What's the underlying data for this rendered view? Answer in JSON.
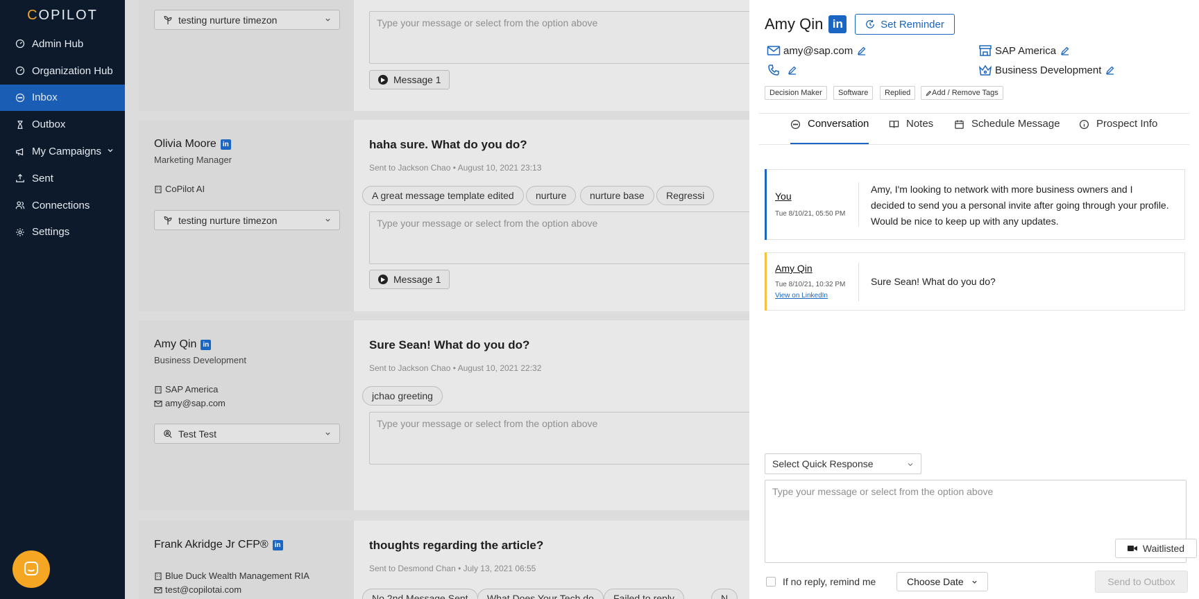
{
  "sidebar": {
    "logo": {
      "first": "C",
      "rest": "OPILOT"
    },
    "items": [
      {
        "label": "Admin Hub",
        "icon": "gauge-icon"
      },
      {
        "label": "Organization Hub",
        "icon": "gauge-icon"
      },
      {
        "label": "Inbox",
        "icon": "chat-icon",
        "active": true
      },
      {
        "label": "Outbox",
        "icon": "hourglass-icon"
      },
      {
        "label": "My Campaigns",
        "icon": "megaphone-icon",
        "has_caret": true
      },
      {
        "label": "Sent",
        "icon": "upload-icon"
      },
      {
        "label": "Connections",
        "icon": "users-icon"
      },
      {
        "label": "Settings",
        "icon": "gear-icon"
      }
    ]
  },
  "cards": [
    {
      "dropdown": "testing nurture timezon",
      "reply_placeholder": "Type your message or select from the option above",
      "message_button": "Message 1"
    },
    {
      "name": "Olivia Moore",
      "role": "Marketing Manager",
      "company": "CoPilot AI",
      "dropdown": "testing nurture timezon",
      "title": "haha sure. What do you do?",
      "sub": "Sent to Jackson Chao • August 10, 2021 23:13",
      "chips": [
        "A great message template edited",
        "nurture",
        "nurture base",
        "Regressi"
      ],
      "reply_placeholder": "Type your message or select from the option above",
      "message_button": "Message 1"
    },
    {
      "name": "Amy Qin",
      "role": "Business Development",
      "company": "SAP America",
      "email": "amy@sap.com",
      "dropdown": "Test Test",
      "title": "Sure Sean! What do you do?",
      "sub": "Sent to Jackson Chao • August 10, 2021 22:32",
      "chips": [
        "jchao greeting"
      ],
      "reply_placeholder": "Type your message or select from the option above"
    },
    {
      "name": "Frank Akridge Jr CFP®",
      "company": "Blue Duck Wealth Management RIA",
      "email": "test@copilotai.com",
      "title": "thoughts regarding the article?",
      "sub": "Sent to Desmond Chan • July 13, 2021 06:55",
      "chips": [
        "No 2nd Message Sent",
        "What Does Your Tech do",
        "Failed to reply",
        "N"
      ]
    }
  ],
  "panel": {
    "name": "Amy Qin",
    "linkedin_badge": "in",
    "reminder_label": "Set Reminder",
    "email": "amy@sap.com",
    "company": "SAP America",
    "department": "Business Development",
    "tags": [
      "Decision Maker",
      "Software",
      "Replied"
    ],
    "add_tags_label": "Add / Remove Tags",
    "tabs": [
      "Conversation",
      "Notes",
      "Schedule Message",
      "Prospect Info"
    ],
    "messages": [
      {
        "sender": "You",
        "time": "Tue 8/10/21, 05:50 PM",
        "text": "Amy, I'm looking to network with more business owners and I decided to send you a personal invite after going through your profile. Would be nice to keep up with any updates.",
        "bar_color": "#1a66c2"
      },
      {
        "sender": "Amy Qin",
        "time": "Tue 8/10/21, 10:32 PM",
        "link": "View on LinkedIn",
        "text": "Sure Sean! What do you do?",
        "bar_color": "#f5c242"
      }
    ],
    "quick_response": "Select Quick Response",
    "compose_placeholder": "Type your message or select from the option above",
    "waitlisted_label": "Waitlisted",
    "remind_label": "If no reply, remind me",
    "date_label": "Choose Date",
    "send_label": "Send to Outbox"
  },
  "colors": {
    "sidebar_bg": "#0c1a2c",
    "active": "#1a5db5",
    "accent": "#1a66c2",
    "logo_accent": "#f2a32b",
    "chat_bubble": "#f5a623"
  }
}
